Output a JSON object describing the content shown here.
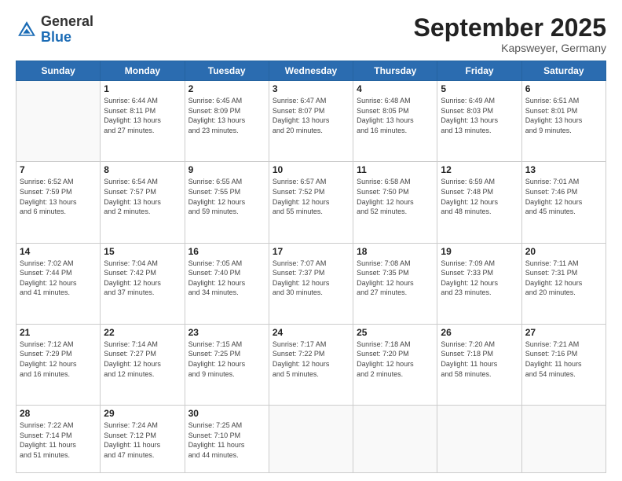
{
  "header": {
    "logo_general": "General",
    "logo_blue": "Blue",
    "month": "September 2025",
    "location": "Kapsweyer, Germany"
  },
  "days_of_week": [
    "Sunday",
    "Monday",
    "Tuesday",
    "Wednesday",
    "Thursday",
    "Friday",
    "Saturday"
  ],
  "weeks": [
    [
      {
        "day": "",
        "info": ""
      },
      {
        "day": "1",
        "info": "Sunrise: 6:44 AM\nSunset: 8:11 PM\nDaylight: 13 hours\nand 27 minutes."
      },
      {
        "day": "2",
        "info": "Sunrise: 6:45 AM\nSunset: 8:09 PM\nDaylight: 13 hours\nand 23 minutes."
      },
      {
        "day": "3",
        "info": "Sunrise: 6:47 AM\nSunset: 8:07 PM\nDaylight: 13 hours\nand 20 minutes."
      },
      {
        "day": "4",
        "info": "Sunrise: 6:48 AM\nSunset: 8:05 PM\nDaylight: 13 hours\nand 16 minutes."
      },
      {
        "day": "5",
        "info": "Sunrise: 6:49 AM\nSunset: 8:03 PM\nDaylight: 13 hours\nand 13 minutes."
      },
      {
        "day": "6",
        "info": "Sunrise: 6:51 AM\nSunset: 8:01 PM\nDaylight: 13 hours\nand 9 minutes."
      }
    ],
    [
      {
        "day": "7",
        "info": "Sunrise: 6:52 AM\nSunset: 7:59 PM\nDaylight: 13 hours\nand 6 minutes."
      },
      {
        "day": "8",
        "info": "Sunrise: 6:54 AM\nSunset: 7:57 PM\nDaylight: 13 hours\nand 2 minutes."
      },
      {
        "day": "9",
        "info": "Sunrise: 6:55 AM\nSunset: 7:55 PM\nDaylight: 12 hours\nand 59 minutes."
      },
      {
        "day": "10",
        "info": "Sunrise: 6:57 AM\nSunset: 7:52 PM\nDaylight: 12 hours\nand 55 minutes."
      },
      {
        "day": "11",
        "info": "Sunrise: 6:58 AM\nSunset: 7:50 PM\nDaylight: 12 hours\nand 52 minutes."
      },
      {
        "day": "12",
        "info": "Sunrise: 6:59 AM\nSunset: 7:48 PM\nDaylight: 12 hours\nand 48 minutes."
      },
      {
        "day": "13",
        "info": "Sunrise: 7:01 AM\nSunset: 7:46 PM\nDaylight: 12 hours\nand 45 minutes."
      }
    ],
    [
      {
        "day": "14",
        "info": "Sunrise: 7:02 AM\nSunset: 7:44 PM\nDaylight: 12 hours\nand 41 minutes."
      },
      {
        "day": "15",
        "info": "Sunrise: 7:04 AM\nSunset: 7:42 PM\nDaylight: 12 hours\nand 37 minutes."
      },
      {
        "day": "16",
        "info": "Sunrise: 7:05 AM\nSunset: 7:40 PM\nDaylight: 12 hours\nand 34 minutes."
      },
      {
        "day": "17",
        "info": "Sunrise: 7:07 AM\nSunset: 7:37 PM\nDaylight: 12 hours\nand 30 minutes."
      },
      {
        "day": "18",
        "info": "Sunrise: 7:08 AM\nSunset: 7:35 PM\nDaylight: 12 hours\nand 27 minutes."
      },
      {
        "day": "19",
        "info": "Sunrise: 7:09 AM\nSunset: 7:33 PM\nDaylight: 12 hours\nand 23 minutes."
      },
      {
        "day": "20",
        "info": "Sunrise: 7:11 AM\nSunset: 7:31 PM\nDaylight: 12 hours\nand 20 minutes."
      }
    ],
    [
      {
        "day": "21",
        "info": "Sunrise: 7:12 AM\nSunset: 7:29 PM\nDaylight: 12 hours\nand 16 minutes."
      },
      {
        "day": "22",
        "info": "Sunrise: 7:14 AM\nSunset: 7:27 PM\nDaylight: 12 hours\nand 12 minutes."
      },
      {
        "day": "23",
        "info": "Sunrise: 7:15 AM\nSunset: 7:25 PM\nDaylight: 12 hours\nand 9 minutes."
      },
      {
        "day": "24",
        "info": "Sunrise: 7:17 AM\nSunset: 7:22 PM\nDaylight: 12 hours\nand 5 minutes."
      },
      {
        "day": "25",
        "info": "Sunrise: 7:18 AM\nSunset: 7:20 PM\nDaylight: 12 hours\nand 2 minutes."
      },
      {
        "day": "26",
        "info": "Sunrise: 7:20 AM\nSunset: 7:18 PM\nDaylight: 11 hours\nand 58 minutes."
      },
      {
        "day": "27",
        "info": "Sunrise: 7:21 AM\nSunset: 7:16 PM\nDaylight: 11 hours\nand 54 minutes."
      }
    ],
    [
      {
        "day": "28",
        "info": "Sunrise: 7:22 AM\nSunset: 7:14 PM\nDaylight: 11 hours\nand 51 minutes."
      },
      {
        "day": "29",
        "info": "Sunrise: 7:24 AM\nSunset: 7:12 PM\nDaylight: 11 hours\nand 47 minutes."
      },
      {
        "day": "30",
        "info": "Sunrise: 7:25 AM\nSunset: 7:10 PM\nDaylight: 11 hours\nand 44 minutes."
      },
      {
        "day": "",
        "info": ""
      },
      {
        "day": "",
        "info": ""
      },
      {
        "day": "",
        "info": ""
      },
      {
        "day": "",
        "info": ""
      }
    ]
  ]
}
